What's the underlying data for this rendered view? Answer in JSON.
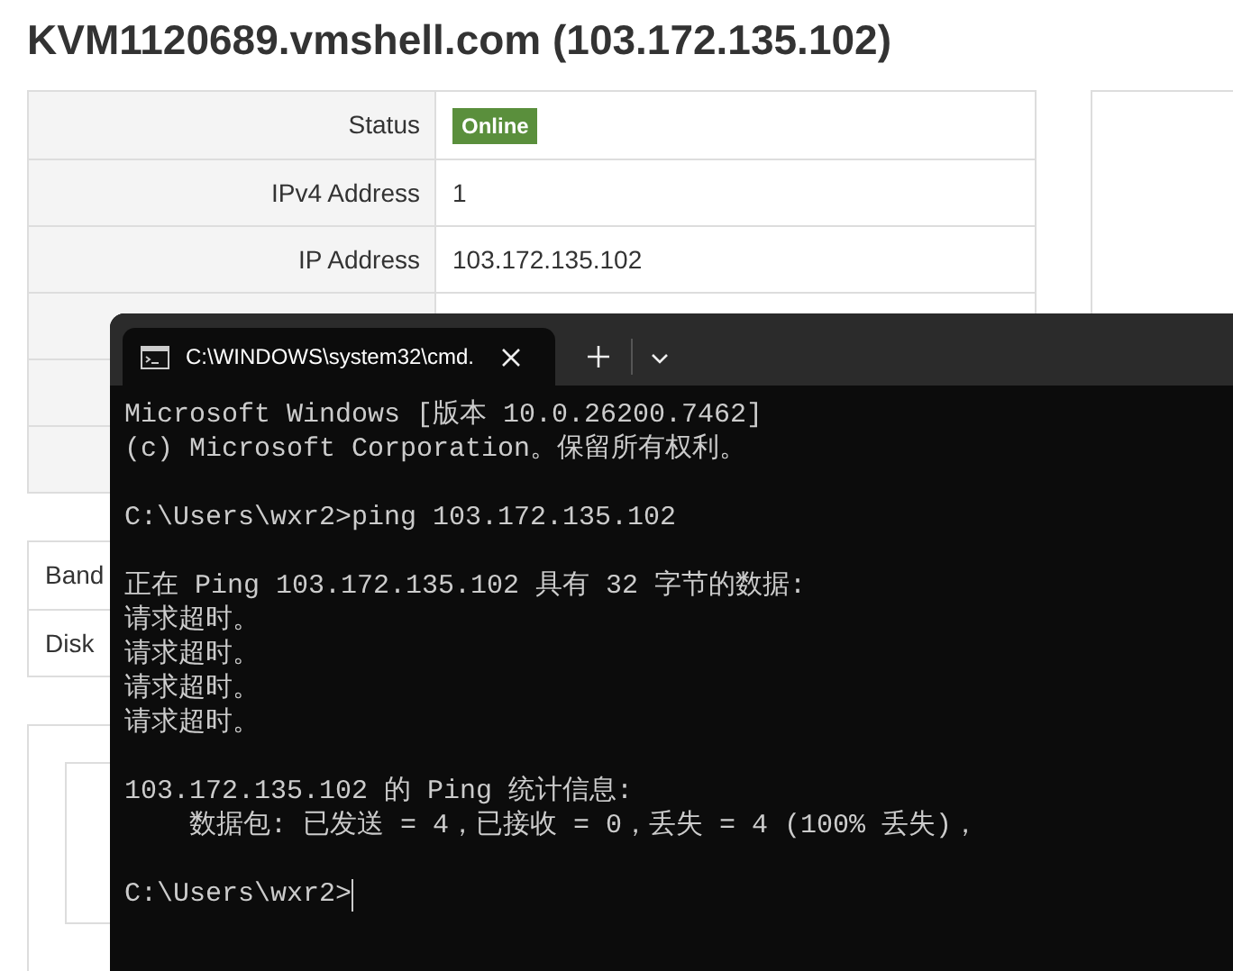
{
  "page_title": "KVM1120689.vmshell.com (103.172.135.102)",
  "details": [
    {
      "label": "Status",
      "value": "Online",
      "kind": "badge"
    },
    {
      "label": "IPv4 Address",
      "value": "1",
      "kind": "text"
    },
    {
      "label": "IP Address",
      "value": "103.172.135.102",
      "kind": "text"
    },
    {
      "kind": "empty"
    },
    {
      "kind": "empty"
    },
    {
      "kind": "empty"
    }
  ],
  "usage": [
    {
      "label": "Band"
    },
    {
      "label": "Disk"
    }
  ],
  "terminal": {
    "tab_title": "C:\\WINDOWS\\system32\\cmd.",
    "blocks": [
      [
        "Microsoft Windows [版本 10.0.26200.7462]",
        "(c) Microsoft Corporation。保留所有权利。"
      ],
      [
        "C:\\Users\\wxr2>ping 103.172.135.102"
      ],
      [
        "正在 Ping 103.172.135.102 具有 32 字节的数据:",
        "请求超时。",
        "请求超时。",
        "请求超时。",
        "请求超时。"
      ],
      [
        "103.172.135.102 的 Ping 统计信息:",
        "    数据包: 已发送 = 4，已接收 = 0，丢失 = 4 (100% 丢失)，"
      ],
      [
        "C:\\Users\\wxr2>"
      ]
    ]
  }
}
